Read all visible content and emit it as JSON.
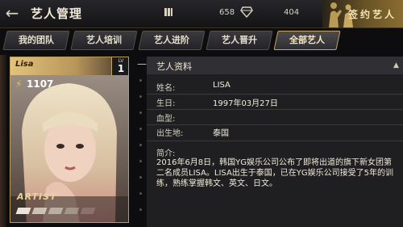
{
  "header": {
    "title": "艺人管理",
    "back_icon": "back-arrow-icon",
    "resources": [
      {
        "icon": "bars-icon",
        "value": "658"
      },
      {
        "icon": "diamond-icon",
        "value": "404"
      }
    ],
    "sign_label": "签约艺人"
  },
  "tabs": [
    {
      "label": "我的团队",
      "active": false
    },
    {
      "label": "艺人培训",
      "active": false
    },
    {
      "label": "艺人进阶",
      "active": false
    },
    {
      "label": "艺人晋升",
      "active": false
    },
    {
      "label": "全部艺人",
      "active": true
    }
  ],
  "card": {
    "name": "Lisa",
    "lv_label": "LV",
    "level": "1",
    "power": "1107",
    "logo": "ARTIST"
  },
  "profile": {
    "title": "艺人资料",
    "fields": [
      {
        "label": "姓名:",
        "value": "LISA"
      },
      {
        "label": "生日:",
        "value": "1997年03月27日"
      },
      {
        "label": "血型:",
        "value": ""
      },
      {
        "label": "出生地:",
        "value": "泰国"
      }
    ],
    "intro_label": "简介:",
    "intro": "2016年6月8日，韩国YG娱乐公司公布了即将出道的旗下新女团第二名成员LISA。LISA出生于泰国，已在YG娱乐公司接受了5年的训练，熟练掌握韩文、英文、日文。"
  },
  "colors": {
    "accent_gold": "#c9a85a",
    "background": "#0d0d0f",
    "panel": "#1f1f22"
  }
}
